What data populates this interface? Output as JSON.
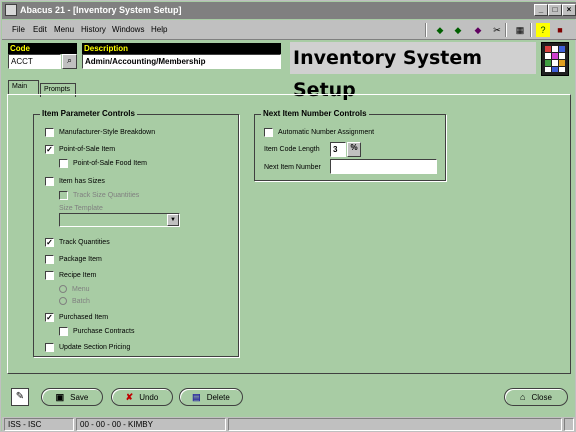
{
  "window": {
    "title": "Abacus 21 - [Inventory System Setup]"
  },
  "menu": [
    "File",
    "Edit",
    "Menu",
    "History",
    "Windows",
    "Help"
  ],
  "header": {
    "code_label": "Code",
    "code_value": "ACCT",
    "description_label": "Description",
    "description_value": "Admin/Accounting/Membership",
    "title": "Inventory System Setup"
  },
  "tabs": [
    {
      "label": "Main",
      "active": true
    },
    {
      "label": "Prompts",
      "active": false
    }
  ],
  "item_parameter_controls": {
    "title": "Item Parameter Controls",
    "manufacturer_style": {
      "label": "Manufacturer-Style Breakdown",
      "checked": false
    },
    "point_of_sale": {
      "label": "Point-of-Sale Item",
      "checked": true
    },
    "point_of_sale_food": {
      "label": "Point-of-Sale Food Item",
      "checked": false
    },
    "item_has_sizes": {
      "label": "Item has Sizes",
      "checked": false
    },
    "track_size_quantities": {
      "label": "Track Size Quantities",
      "checked": false,
      "disabled": true
    },
    "size_template_label": "Size Template",
    "track_quantities": {
      "label": "Track Quantities",
      "checked": true
    },
    "package_item": {
      "label": "Package Item",
      "checked": false
    },
    "recipe_item": {
      "label": "Recipe Item",
      "checked": false
    },
    "radio_menu": "Menu",
    "radio_batch": "Batch",
    "purchased_item": {
      "label": "Purchased Item",
      "checked": true
    },
    "purchase_contracts": {
      "label": "Purchase Contracts",
      "checked": false
    },
    "update_section_pricing": {
      "label": "Update Section Pricing",
      "checked": false
    }
  },
  "next_item_number_controls": {
    "title": "Next Item Number Controls",
    "auto_number": {
      "label": "Automatic Number Assignment",
      "checked": false
    },
    "code_length_label": "Item Code Length",
    "code_length_value": "3",
    "next_number_label": "Next Item Number",
    "next_number_value": ""
  },
  "buttons": {
    "save": "Save",
    "undo": "Undo",
    "delete": "Delete",
    "close": "Close"
  },
  "status": {
    "left": "ISS - ISC",
    "middle": "00 - 00 - 00 - KIMBY"
  }
}
